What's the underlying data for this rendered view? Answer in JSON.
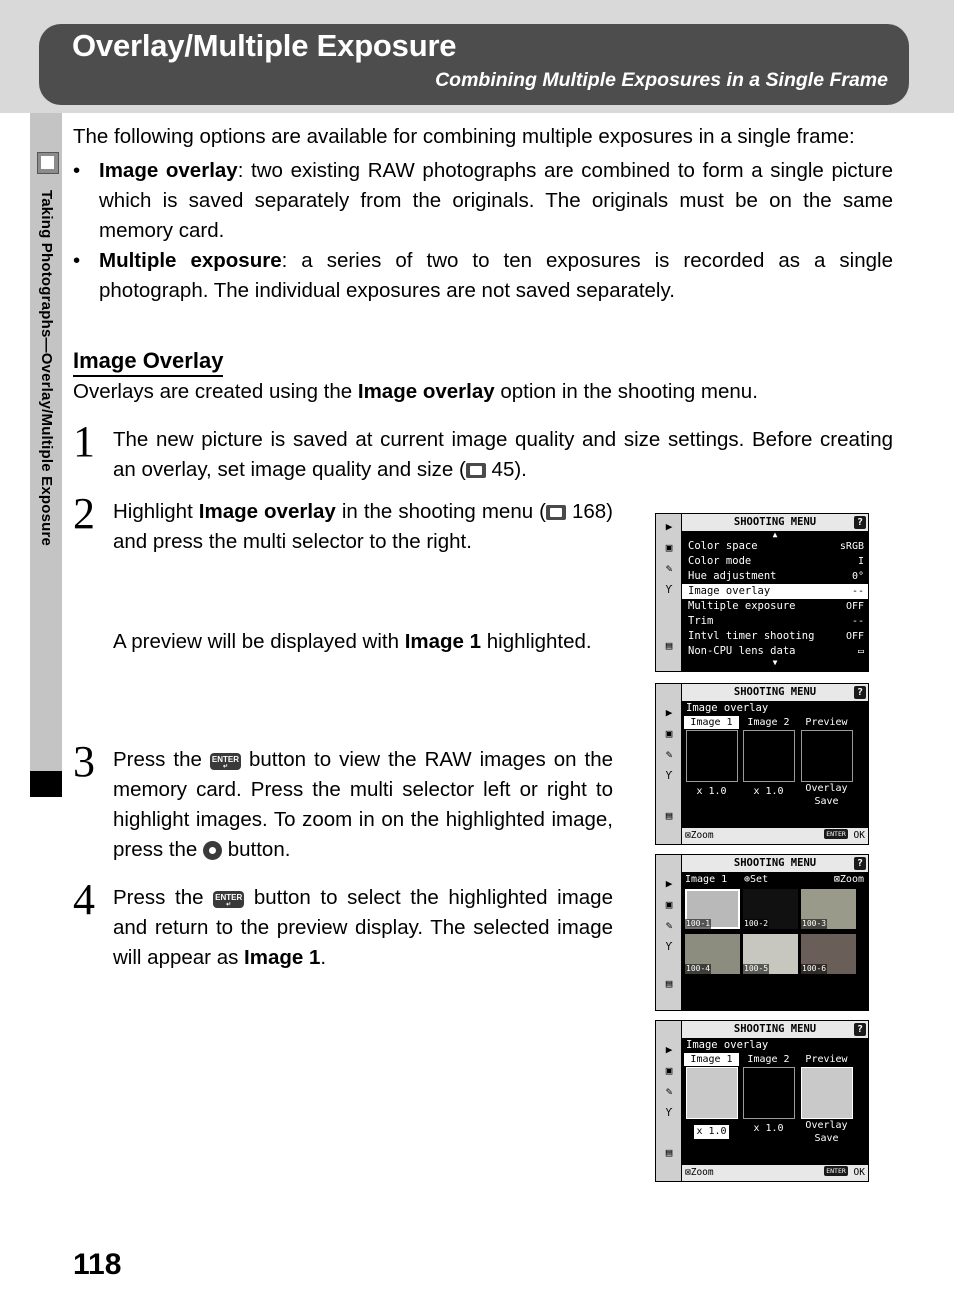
{
  "header": {
    "title": "Overlay/Multiple Exposure",
    "subtitle": "Combining Multiple Exposures in a Single Frame"
  },
  "side_tab": {
    "label": "Taking Photographs—Overlay/Multiple Exposure"
  },
  "intro": "The following options are available for combining multiple exposures in a single frame:",
  "bullets": [
    {
      "term": "Image overlay",
      "rest": ": two existing RAW photographs are combined to form a single picture which is saved separately from the originals.  The originals must be on the same memory card."
    },
    {
      "term": "Multiple exposure",
      "rest": ": a series of two to ten exposures is recorded as a single photograph.  The individual exposures are not saved separately."
    }
  ],
  "section": {
    "heading": "Image Overlay",
    "lead_a": "Overlays are created using the ",
    "lead_b": "Image overlay",
    "lead_c": " option in the shooting menu."
  },
  "steps": [
    {
      "num": "1",
      "parts": {
        "a": "The new picture is saved at current image quality and size settings.  Before creating an overlay, set image quality and size (",
        "b": " 45)."
      }
    },
    {
      "num": "2",
      "parts": {
        "a": "Highlight ",
        "bold": "Image overlay",
        "b": " in the shooting menu (",
        "c": " 168) and press the multi selector to the right."
      },
      "follow": {
        "a": "A preview will be displayed with ",
        "bold": "Image 1",
        "b": " highlighted."
      }
    },
    {
      "num": "3",
      "parts": {
        "a": "Press the ",
        "b": " button to view the RAW images on the memory card.  Press the multi selector left or right to highlight images.  To zoom in on the highlighted image, press the ",
        "c": " button."
      }
    },
    {
      "num": "4",
      "parts": {
        "a": "Press the ",
        "b": " button to select the highlighted image and return to the preview display.  The selected image will appear as ",
        "bold": "Image 1",
        "c": "."
      }
    }
  ],
  "lcd_menu": {
    "title": "SHOOTING MENU",
    "help_icon": "?",
    "rail_icons": [
      "play-icon",
      "camera-icon",
      "pencil-icon",
      "wrench-icon",
      "list-icon"
    ],
    "rows": [
      {
        "label": "Color space",
        "value": "sRGB",
        "selected": false
      },
      {
        "label": "Color mode",
        "value": "I",
        "selected": false
      },
      {
        "label": "Hue adjustment",
        "value": "0°",
        "selected": false
      },
      {
        "label": "Image overlay",
        "value": "--",
        "selected": true
      },
      {
        "label": "Multiple exposure",
        "value": "OFF",
        "selected": false
      },
      {
        "label": "Trim",
        "value": "--",
        "selected": false
      },
      {
        "label": "Intvl timer shooting",
        "value": "OFF",
        "selected": false
      },
      {
        "label": "Non-CPU lens data",
        "value": "▭",
        "selected": false
      }
    ]
  },
  "lcd_overlay_a": {
    "title": "SHOOTING MENU",
    "help_icon": "?",
    "heading": "Image overlay",
    "columns": [
      {
        "header": "Image 1",
        "highlighted": true,
        "zoom": "x 1.0",
        "thumb": "empty"
      },
      {
        "header": "Image 2",
        "highlighted": false,
        "zoom": "x 1.0",
        "thumb": "empty"
      },
      {
        "header": "Preview",
        "highlighted": false,
        "actions": [
          "Overlay",
          "Save"
        ],
        "thumb": "empty"
      }
    ],
    "footer_left": "Zoom",
    "footer_right_badge": "ENTER",
    "footer_right": "OK"
  },
  "lcd_thumbs": {
    "title": "SHOOTING MENU",
    "help_icon": "?",
    "top_left": "Image 1",
    "top_mid": "Set",
    "top_right": "Zoom",
    "cells": [
      {
        "caption": "100-1",
        "selected": true
      },
      {
        "caption": "100-2",
        "selected": false
      },
      {
        "caption": "100-3",
        "selected": false
      },
      {
        "caption": "100-4",
        "selected": false
      },
      {
        "caption": "100-5",
        "selected": false
      },
      {
        "caption": "100-6",
        "selected": false
      }
    ]
  },
  "lcd_overlay_b": {
    "title": "SHOOTING MENU",
    "help_icon": "?",
    "heading": "Image overlay",
    "columns": [
      {
        "header": "Image 1",
        "highlighted": true,
        "zoom": "x 1.0",
        "zoom_highlighted": true,
        "thumb": "filled"
      },
      {
        "header": "Image 2",
        "highlighted": false,
        "zoom": "x 1.0",
        "thumb": "empty"
      },
      {
        "header": "Preview",
        "highlighted": false,
        "actions": [
          "Overlay",
          "Save"
        ],
        "thumb": "filled"
      }
    ],
    "footer_left": "Zoom",
    "footer_right_badge": "ENTER",
    "footer_right": "OK"
  },
  "page_number": "118"
}
